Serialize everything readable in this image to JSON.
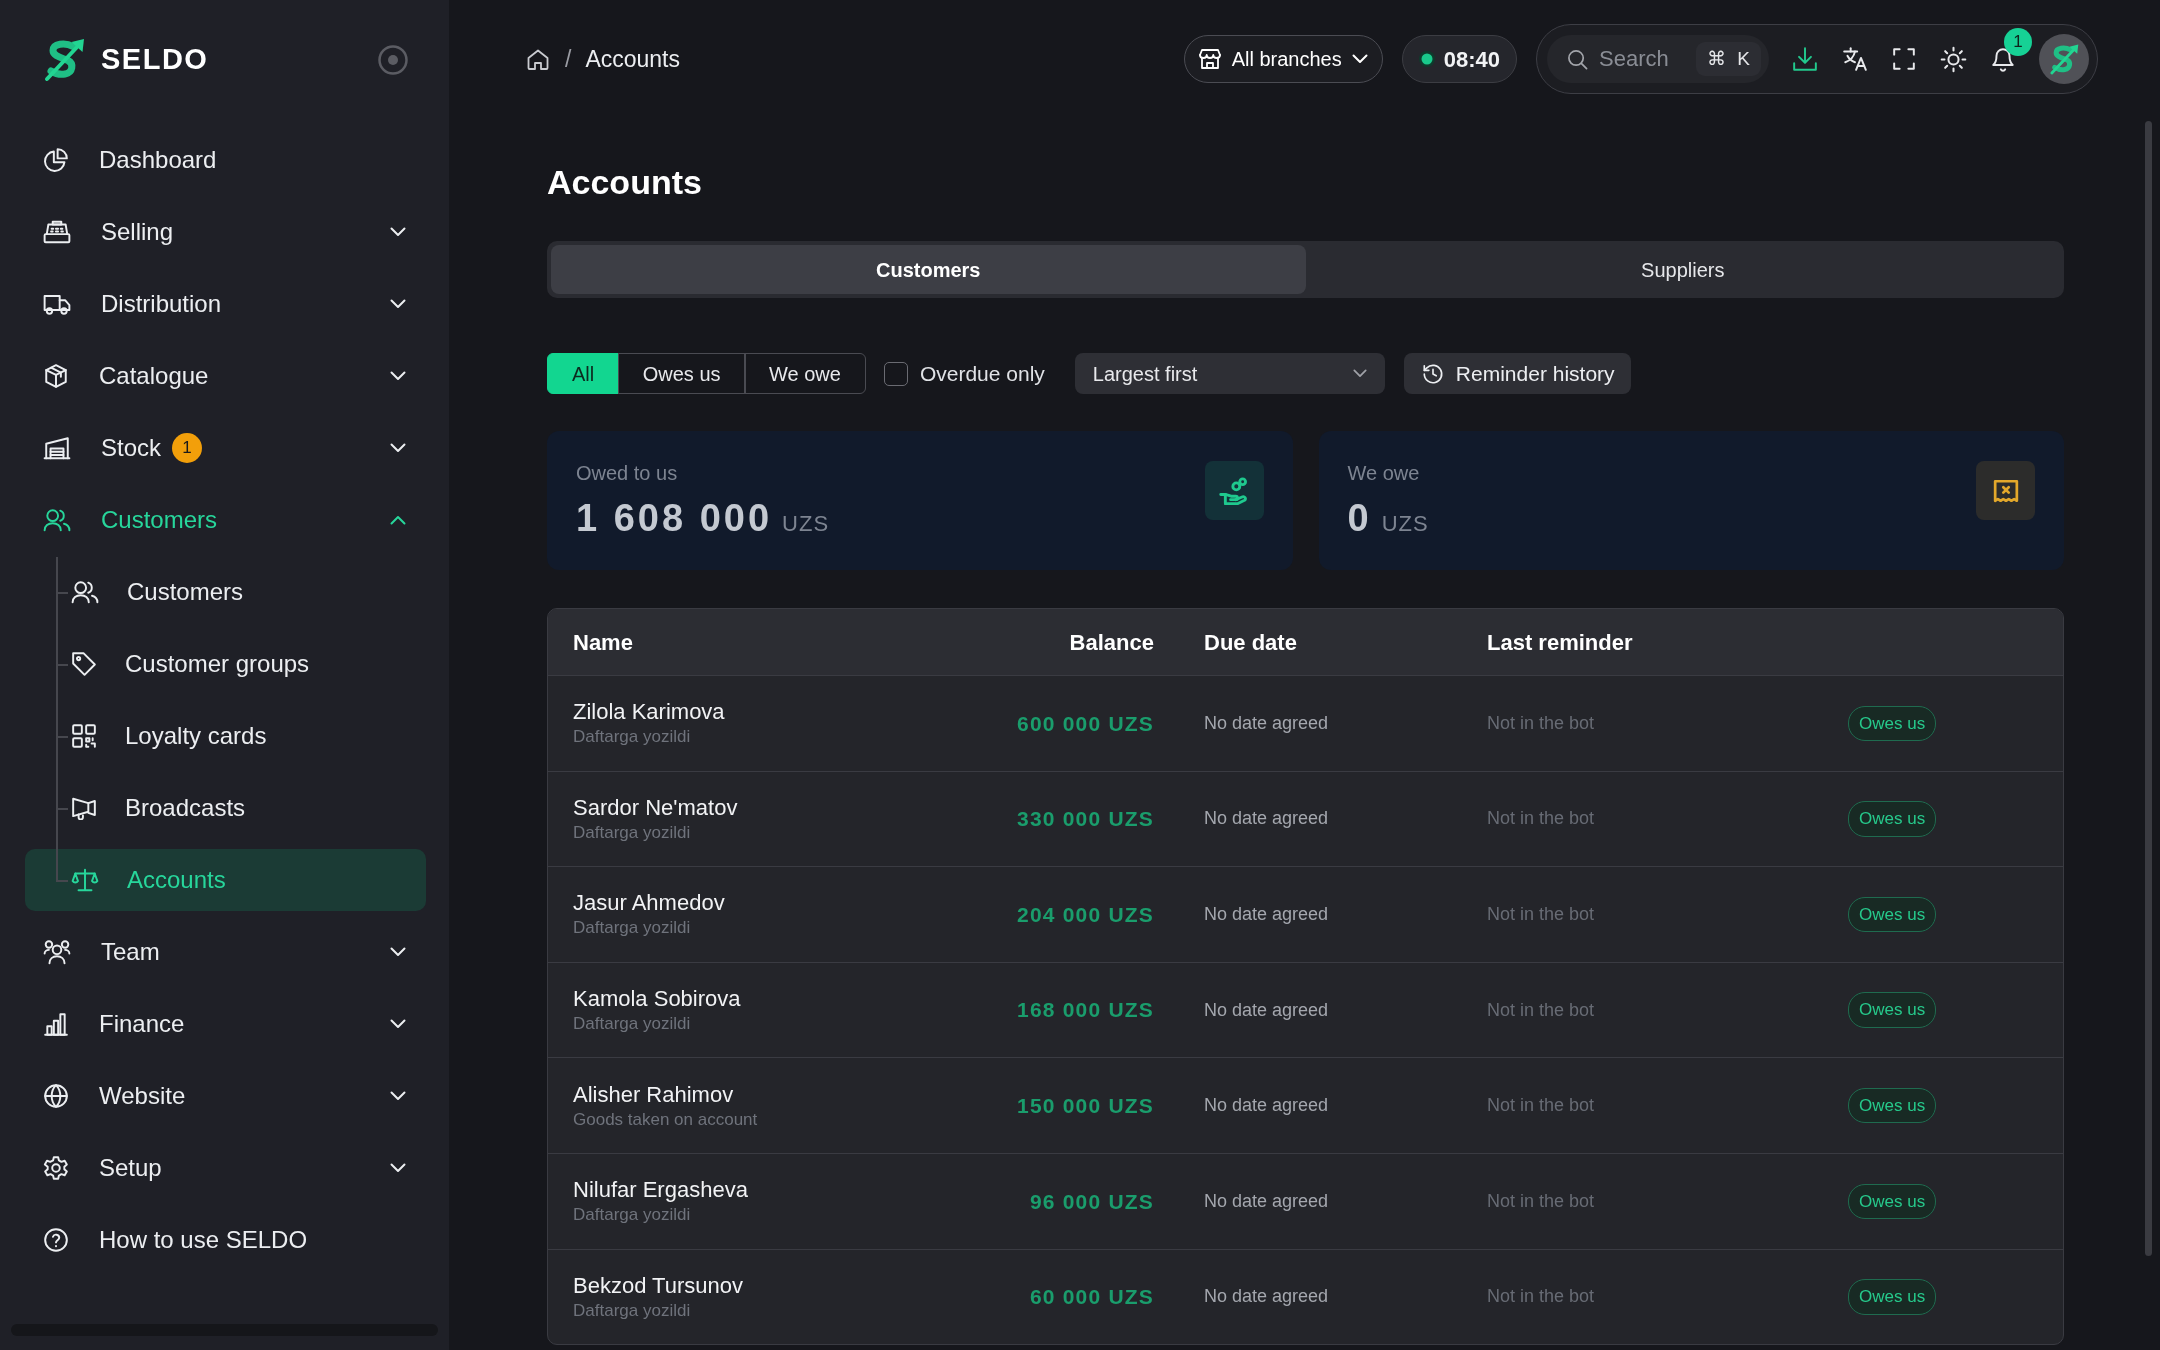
{
  "sidebar": {
    "brand": "SELDO",
    "items": [
      {
        "kind": "link",
        "label": "Dashboard",
        "selected": false
      },
      {
        "kind": "group",
        "label": "Selling",
        "expanded": false,
        "selected": false
      },
      {
        "kind": "group",
        "label": "Distribution",
        "expanded": false,
        "selected": false
      },
      {
        "kind": "group",
        "label": "Catalogue",
        "expanded": false,
        "selected": false
      },
      {
        "kind": "group",
        "label": "Stock",
        "badge": "1",
        "expanded": false,
        "selected": false
      },
      {
        "kind": "group",
        "label": "Customers",
        "expanded": true,
        "selected": false,
        "children": [
          {
            "label": "Customers",
            "selected": false
          },
          {
            "label": "Customer groups",
            "selected": false
          },
          {
            "label": "Loyalty cards",
            "selected": false
          },
          {
            "label": "Broadcasts",
            "selected": false
          },
          {
            "label": "Accounts",
            "selected": true
          }
        ]
      },
      {
        "kind": "group",
        "label": "Team",
        "expanded": false,
        "selected": false
      },
      {
        "kind": "group",
        "label": "Finance",
        "expanded": false,
        "selected": false
      },
      {
        "kind": "group",
        "label": "Website",
        "expanded": false,
        "selected": false
      },
      {
        "kind": "group",
        "label": "Setup",
        "expanded": false,
        "selected": false
      },
      {
        "kind": "link",
        "label": "How to use SELDO",
        "selected": false
      }
    ]
  },
  "header": {
    "breadcrumb": {
      "separator": "/",
      "items": [
        "Accounts"
      ]
    },
    "branch_selector": "All branches",
    "time": "08:40",
    "search": {
      "placeholder": "Search",
      "shortcut": "⌘ K"
    },
    "notifications_count": "1"
  },
  "page": {
    "title": "Accounts",
    "tabs": [
      {
        "label": "Customers",
        "selected": true
      },
      {
        "label": "Suppliers",
        "selected": false
      }
    ],
    "filters": {
      "segments": [
        {
          "label": "All",
          "selected": true
        },
        {
          "label": "Owes us",
          "selected": false
        },
        {
          "label": "We owe",
          "selected": false
        }
      ],
      "overdue_only": {
        "label": "Overdue only",
        "checked": false
      },
      "sort": {
        "value": "Largest first"
      },
      "reminder_history_button": "Reminder history"
    },
    "summary_cards": [
      {
        "label": "Owed to us",
        "amount": "1 608 000",
        "currency": "UZS",
        "color": "#1fc98e"
      },
      {
        "label": "We owe",
        "amount": "0",
        "currency": "UZS",
        "color": "#e3a82b"
      }
    ],
    "table": {
      "columns": [
        "Name",
        "Balance",
        "Due date",
        "Last reminder"
      ],
      "rows": [
        {
          "name": "Zilola Karimova",
          "note": "Daftarga yozildi",
          "balance": "600 000 UZS",
          "due_date": "No date agreed",
          "last_reminder": "Not in the bot",
          "status": "Owes us"
        },
        {
          "name": "Sardor Ne'matov",
          "note": "Daftarga yozildi",
          "balance": "330 000 UZS",
          "due_date": "No date agreed",
          "last_reminder": "Not in the bot",
          "status": "Owes us"
        },
        {
          "name": "Jasur Ahmedov",
          "note": "Daftarga yozildi",
          "balance": "204 000 UZS",
          "due_date": "No date agreed",
          "last_reminder": "Not in the bot",
          "status": "Owes us"
        },
        {
          "name": "Kamola Sobirova",
          "note": "Daftarga yozildi",
          "balance": "168 000 UZS",
          "due_date": "No date agreed",
          "last_reminder": "Not in the bot",
          "status": "Owes us"
        },
        {
          "name": "Alisher Rahimov",
          "note": "Goods taken on account",
          "balance": "150 000 UZS",
          "due_date": "No date agreed",
          "last_reminder": "Not in the bot",
          "status": "Owes us"
        },
        {
          "name": "Nilufar Ergasheva",
          "note": "Daftarga yozildi",
          "balance": "96 000 UZS",
          "due_date": "No date agreed",
          "last_reminder": "Not in the bot",
          "status": "Owes us"
        },
        {
          "name": "Bekzod Tursunov",
          "note": "Daftarga yozildi",
          "balance": "60 000 UZS",
          "due_date": "No date agreed",
          "last_reminder": "Not in the bot",
          "status": "Owes us"
        }
      ]
    }
  }
}
